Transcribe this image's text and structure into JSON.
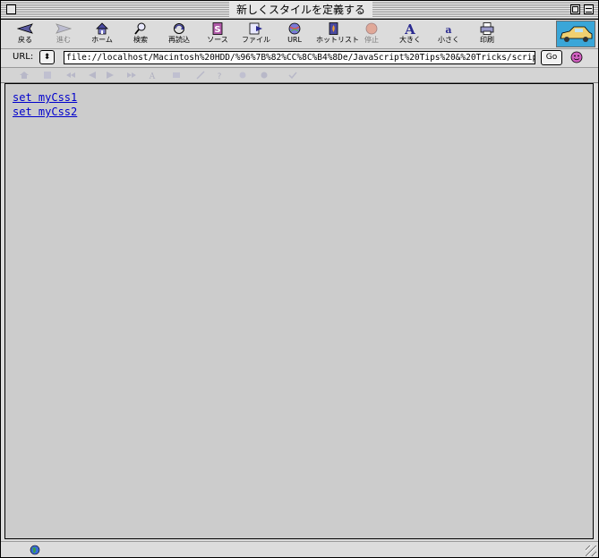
{
  "window": {
    "title": "新しくスタイルを定義する"
  },
  "toolbar": {
    "buttons": [
      {
        "label": "戻る",
        "icon": "back-arrow-icon",
        "enabled": true
      },
      {
        "label": "進む",
        "icon": "forward-arrow-icon",
        "enabled": false
      },
      {
        "label": "ホーム",
        "icon": "home-icon",
        "enabled": true
      },
      {
        "label": "検索",
        "icon": "search-icon",
        "enabled": true
      },
      {
        "label": "再読込",
        "icon": "reload-icon",
        "enabled": true
      },
      {
        "label": "ソース",
        "icon": "source-icon",
        "enabled": true
      },
      {
        "label": "ファイル",
        "icon": "file-icon",
        "enabled": true
      },
      {
        "label": "URL",
        "icon": "url-globe-icon",
        "enabled": true
      },
      {
        "label": "ホットリスト",
        "icon": "hotlist-icon",
        "enabled": true
      },
      {
        "label": "停止",
        "icon": "stop-icon",
        "enabled": false
      },
      {
        "label": "大きく",
        "icon": "font-larger-icon",
        "enabled": true
      },
      {
        "label": "小さく",
        "icon": "font-smaller-icon",
        "enabled": true
      },
      {
        "label": "印刷",
        "icon": "print-icon",
        "enabled": true
      }
    ]
  },
  "urlbar": {
    "label": "URL:",
    "value": "file://localhost/Macintosh%20HDD/%96%7B%82%CC%8C%B4%8De/JavaScript%20Tips%20&%20Tricks/scrip",
    "go_label": "Go"
  },
  "content": {
    "links": [
      {
        "text": "set myCss1"
      },
      {
        "text": "set myCss2"
      }
    ]
  },
  "colors": {
    "content_bg": "#cccccc",
    "chrome_bg": "#dcdcdc",
    "link": "#0000cc",
    "throbber": "#3aa6d8"
  }
}
